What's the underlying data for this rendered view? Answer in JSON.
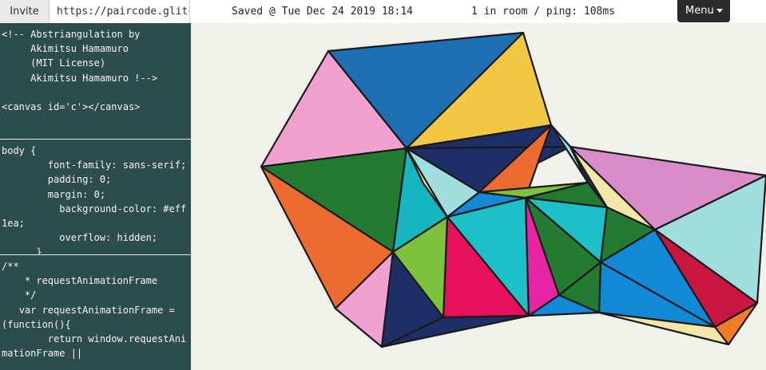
{
  "topbar": {
    "invite_label": "Invite",
    "url_value": "https://paircode.glitc",
    "saved_status": "Saved @ Tue Dec 24 2019 18:14",
    "room_status": "1 in room / ping: 108ms",
    "menu_label": "Menu"
  },
  "editor": {
    "html_code": "<!-- Abstriangulation by\n     Akimitsu Hamamuro\n     (MIT License)\n     Akimitsu Hamamuro !-->\n\n<canvas id='c'></canvas>",
    "css_code": "body {\n        font-family: sans-serif;\n        padding: 0;\n        margin: 0;\n          background-color: #eff1ea;\n          overflow: hidden;\n      }",
    "js_code": "/**\n    * requestAnimationFrame\n    */\n   var requestAnimationFrame = (function(){\n        return window.requestAnimationFrame ||"
  },
  "preview": {
    "background": "#eff1ea",
    "stroke_color": "#1a1a1a",
    "palette": {
      "blue": "#1f6fb3",
      "yellow": "#f2c744",
      "pink": "#f0a1cf",
      "navy": "#1d2f66",
      "green": "#237a31",
      "orange": "#ed6b30",
      "lime": "#7cc23d",
      "teal": "#17b5c0",
      "cyan": "#1ec0c8",
      "aqua": "#9fdedd",
      "red": "#e8105a",
      "magenta": "#e624a4",
      "mauve": "#d98cc8",
      "skyblue": "#1289d6",
      "crimson": "#c8163f",
      "paleyellow": "#f3e6a8",
      "bright_orange": "#f57a28"
    }
  }
}
